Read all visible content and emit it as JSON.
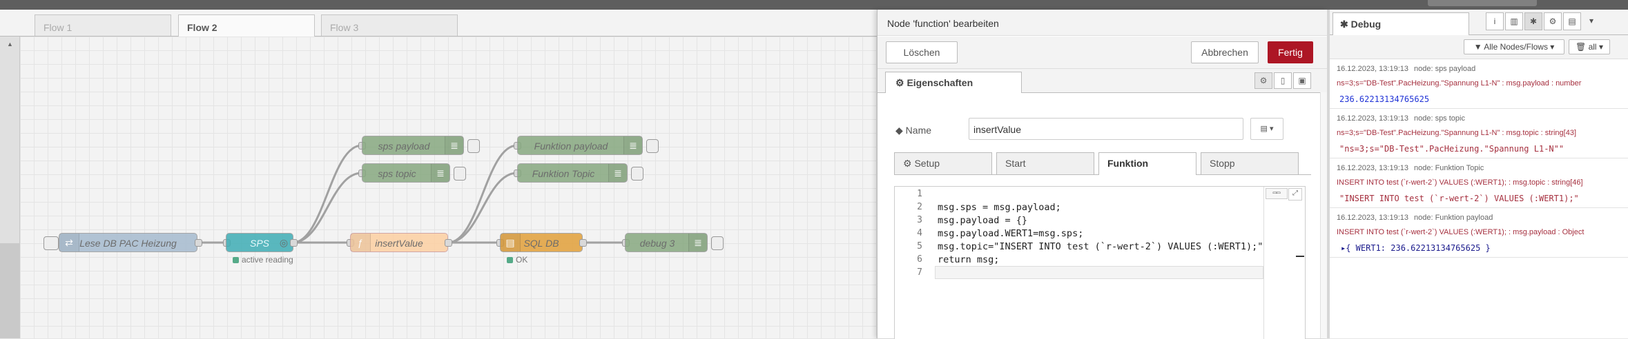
{
  "workspace": {
    "tabs": [
      {
        "label": "Flow 1"
      },
      {
        "label": "Flow 2"
      },
      {
        "label": "Flow 3"
      }
    ],
    "nodes": {
      "inject": {
        "label": "Lese DB PAC Heizung"
      },
      "sps": {
        "label": "SPS",
        "status": "active reading"
      },
      "insert": {
        "label": "insertValue"
      },
      "sqldb": {
        "label": "SQL DB",
        "status": "OK"
      },
      "debug3": {
        "label": "debug 3"
      },
      "sps_payload": {
        "label": "sps payload"
      },
      "sps_topic": {
        "label": "sps topic"
      },
      "fn_payload": {
        "label": "Funktion payload"
      },
      "fn_topic": {
        "label": "Funktion Topic"
      }
    },
    "colors": {
      "inject": "#a6bbcf",
      "sps": "#3fadb5",
      "function": "#fdd0a2",
      "sql": "#e2a03a",
      "debug": "#87a980",
      "status_ok": "#55aa88"
    }
  },
  "editor": {
    "title": "Node 'function' bearbeiten",
    "delete_label": "Löschen",
    "cancel_label": "Abbrechen",
    "done_label": "Fertig",
    "properties_tab": "Eigenschaften",
    "name_label": "Name",
    "name_value": "insertValue",
    "subtabs": [
      {
        "label": "Setup"
      },
      {
        "label": "Start"
      },
      {
        "label": "Funktion"
      },
      {
        "label": "Stopp"
      }
    ],
    "code_lines": [
      {
        "n": "1",
        "text": ""
      },
      {
        "n": "2",
        "text": "msg.sps = msg.payload;"
      },
      {
        "n": "3",
        "text": "msg.payload = {}"
      },
      {
        "n": "4",
        "text": "msg.payload.WERT1=msg.sps;"
      },
      {
        "n": "5",
        "text": "msg.topic=\"INSERT INTO test (`r-wert-2`) VALUES (:WERT1);\""
      },
      {
        "n": "6",
        "text": "return msg;"
      },
      {
        "n": "7",
        "text": ""
      }
    ]
  },
  "debug": {
    "tab_label": "Debug",
    "filter_label": "Alle Nodes/Flows",
    "clear_label": "all",
    "messages": [
      {
        "time": "16.12.2023, 13:19:13",
        "node": "node: sps payload",
        "path": "ns=3;s=\"DB-Test\".PacHeizung.\"Spannung L1-N\" : msg.payload : number",
        "value": "236.62213134765625",
        "kind": "num"
      },
      {
        "time": "16.12.2023, 13:19:13",
        "node": "node: sps topic",
        "path": "ns=3;s=\"DB-Test\".PacHeizung.\"Spannung L1-N\" : msg.topic : string[43]",
        "value": "\"ns=3;s=\"DB-Test\".PacHeizung.\"Spannung L1-N\"\"",
        "kind": "str"
      },
      {
        "time": "16.12.2023, 13:19:13",
        "node": "node: Funktion Topic",
        "path": "INSERT INTO test (`r-wert-2`) VALUES (:WERT1); : msg.topic : string[46]",
        "value": "\"INSERT INTO test (`r-wert-2`) VALUES (:WERT1);\"",
        "kind": "str"
      },
      {
        "time": "16.12.2023, 13:19:13",
        "node": "node: Funktion payload",
        "path": "INSERT INTO test (`r-wert-2`) VALUES (:WERT1); : msg.payload : Object",
        "value": "▸{ WERT1: 236.62213134765625 }",
        "kind": "obj"
      }
    ]
  }
}
